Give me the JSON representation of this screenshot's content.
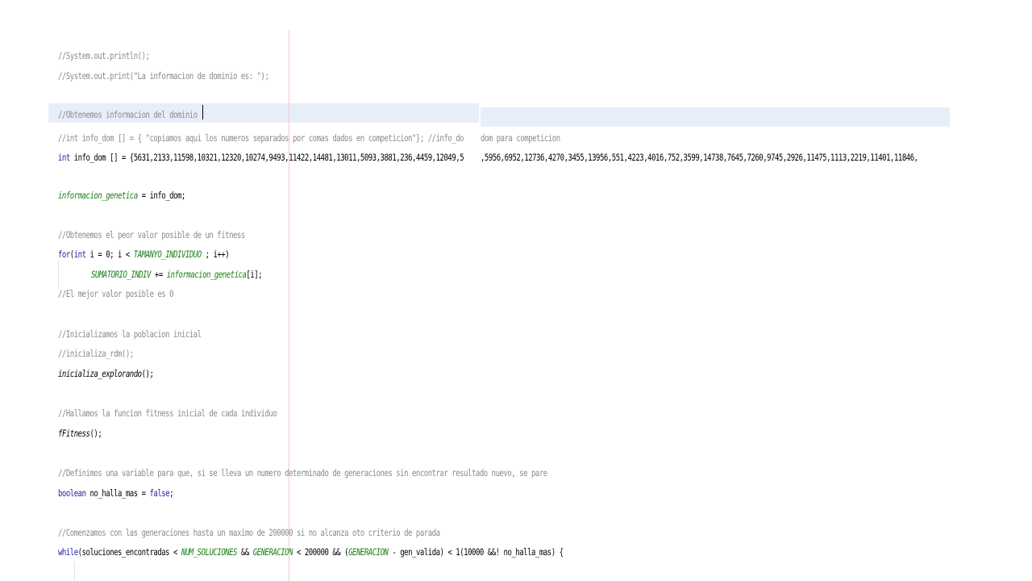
{
  "editor": {
    "lines": [
      "//System.out.println();",
      "//System.out.print(\"La informacion de dominio es: \");",
      "//Obtenemos informacion del dominio",
      "//int info_dom [] = { \"copiamos aqui los numeros separados por comas dados en competicion\"}; //info_do",
      "int info_dom [] = {5631,2133,11598,10321,12320,10274,9493,11422,14481,13011,5093,3881,236,4459,12049,5",
      "informacion_genetica = info_dom;",
      "//Obtenemos el peor valor posible de un fitness",
      "for(int i = 0; i < TAMANYO_INDIVIDUO ; i++)",
      "SUMATORIO_INDIV += informacion_genetica[i];",
      "//El mejor valor posible es 0",
      "//Inicializamos la poblacion inicial",
      "//inicializa_rdm();",
      "inicializa_explorando();",
      "//Hallamos la funcion fitness inicial de cada individuo",
      "fFitness();",
      "//Definimos una variable para que, si se lleva un numero determinado de generaciones sin encontrar resultado nuevo, se pare",
      "boolean no_halla_mas = false;",
      "//Comenzamos con las generaciones hasta un maximo de 200000 si no alcanza oto criterio de parada",
      "while(soluciones_encontradas < NUM_SOLUCIONES && GENERACION < 200000 && (GENERACION - gen_valida) < 1(10000 &&! no_halla_mas) {"
    ],
    "overflow": {
      "comment_tail": "dom para competicion",
      "numbers_tail": ",5956,6952,12736,4270,3455,13956,551,4223,4016,752,3599,14738,7645,7260,9745,2926,11475,1113,2219,11401,11846,"
    },
    "colors": {
      "comment": "#8a8a8a",
      "keyword": "#1f1fa8",
      "field": "#1a7f1a",
      "highlight": "#e8eef9",
      "margin": "#f2c8c0"
    }
  }
}
